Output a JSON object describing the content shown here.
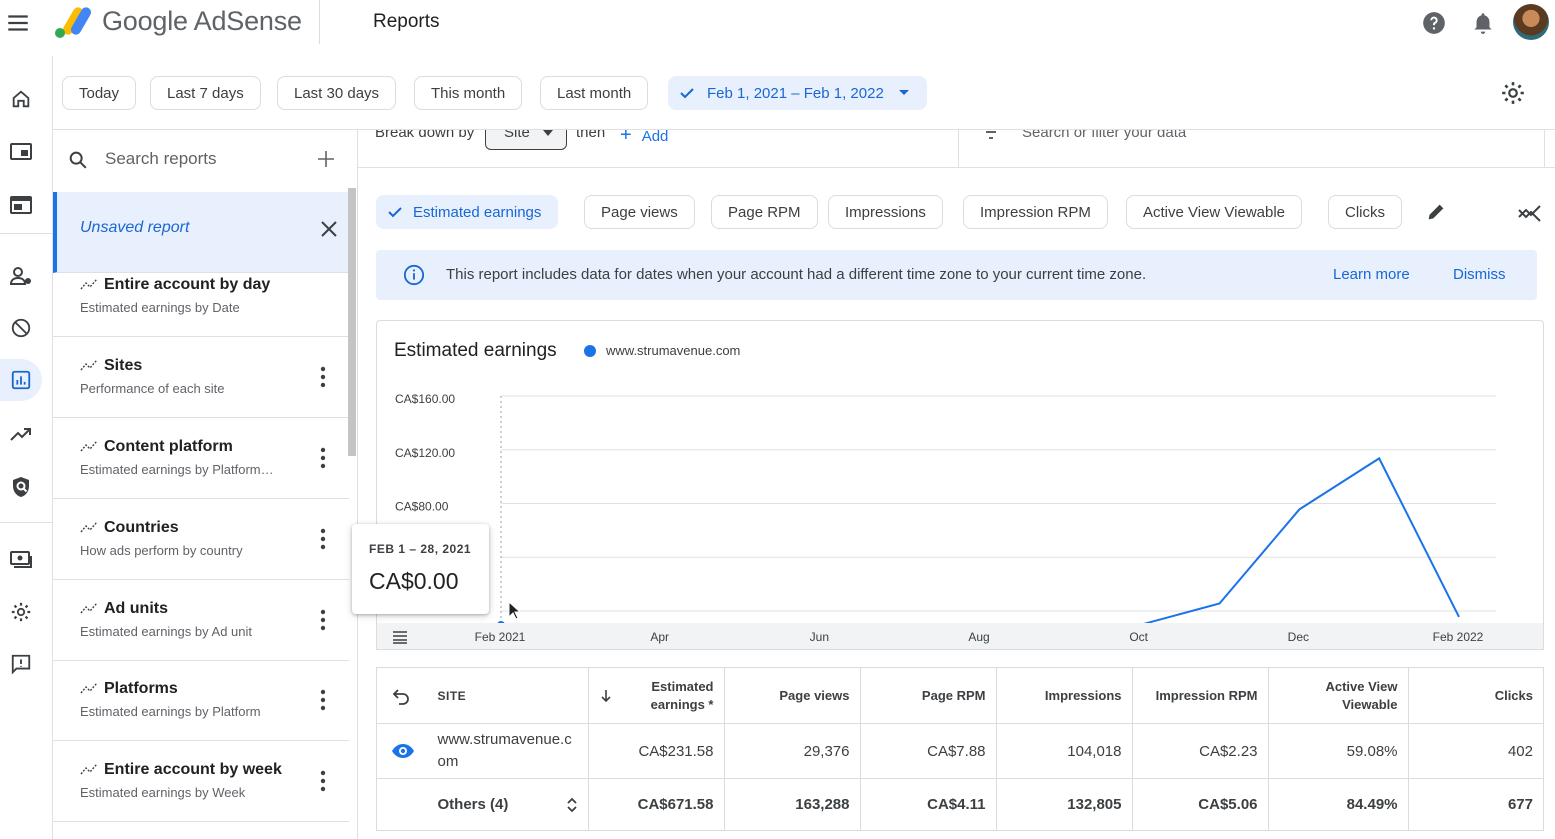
{
  "app": {
    "brand": "Google AdSense",
    "page_title": "Reports"
  },
  "date_range": {
    "chips": [
      "Today",
      "Last 7 days",
      "Last 30 days",
      "This month",
      "Last month"
    ],
    "selected": "Feb 1, 2021 – Feb 1, 2022"
  },
  "sidebar": {
    "search_placeholder": "Search reports",
    "unsaved_label": "Unsaved report",
    "items": [
      {
        "title": "Entire account by day",
        "subtitle": "Estimated earnings by Date"
      },
      {
        "title": "Sites",
        "subtitle": "Performance of each site"
      },
      {
        "title": "Content platform",
        "subtitle": "Estimated earnings by Platform…"
      },
      {
        "title": "Countries",
        "subtitle": "How ads perform by country"
      },
      {
        "title": "Ad units",
        "subtitle": "Estimated earnings by Ad unit"
      },
      {
        "title": "Platforms",
        "subtitle": "Estimated earnings by Platform"
      },
      {
        "title": "Entire account by week",
        "subtitle": "Estimated earnings by Week"
      }
    ]
  },
  "breakdown": {
    "label": "Break down by",
    "value": "Site",
    "then": "then",
    "add": "Add",
    "filter_placeholder": "Search or filter your data"
  },
  "metrics": {
    "selected": "Estimated earnings",
    "chips": [
      "Page views",
      "Page RPM",
      "Impressions",
      "Impression RPM",
      "Active View Viewable",
      "Clicks"
    ]
  },
  "banner": {
    "message": "This report includes data for dates when your account had a different time zone to your current time zone.",
    "learn_more": "Learn more",
    "dismiss": "Dismiss"
  },
  "chart": {
    "title": "Estimated earnings",
    "legend": "www.strumavenue.com",
    "tooltip_range": "FEB 1 – 28, 2021",
    "tooltip_value": "CA$0.00"
  },
  "chart_data": {
    "type": "line",
    "title": "Estimated earnings",
    "series": [
      {
        "name": "www.strumavenue.com",
        "x": [
          "2021-02",
          "2021-03",
          "2021-04",
          "2021-05",
          "2021-06",
          "2021-07",
          "2021-08",
          "2021-09",
          "2021-10",
          "2021-11",
          "2021-12",
          "2022-01",
          "2022-02"
        ],
        "values": [
          0,
          0,
          0,
          0,
          0,
          0,
          0,
          0,
          0,
          16,
          86,
          124,
          6
        ]
      }
    ],
    "x_tick_labels": [
      "Feb 2021",
      "Apr",
      "Jun",
      "Aug",
      "Oct",
      "Dec",
      "Feb 2022"
    ],
    "y_tick_labels": [
      "CA$160.00",
      "CA$120.00",
      "CA$80.00"
    ],
    "ylim": [
      0,
      160
    ],
    "grid": true,
    "legend_position": "top"
  },
  "table": {
    "headers": {
      "site": "SITE",
      "earnings": "Estimated earnings *",
      "page_views": "Page views",
      "page_rpm": "Page RPM",
      "impressions": "Impressions",
      "impression_rpm": "Impression RPM",
      "active_view": "Active View Viewable",
      "clicks": "Clicks"
    },
    "rows": [
      {
        "site": "www.strumavenue.com",
        "earnings": "CA$231.58",
        "page_views": "29,376",
        "page_rpm": "CA$7.88",
        "impressions": "104,018",
        "impression_rpm": "CA$2.23",
        "active_view": "59.08%",
        "clicks": "402"
      },
      {
        "site": "Others (4)",
        "earnings": "CA$671.58",
        "page_views": "163,288",
        "page_rpm": "CA$4.11",
        "impressions": "132,805",
        "impression_rpm": "CA$5.06",
        "active_view": "84.49%",
        "clicks": "677"
      }
    ]
  },
  "colors": {
    "accent": "#1a73e8",
    "selected_bg": "#e8f0fe"
  }
}
